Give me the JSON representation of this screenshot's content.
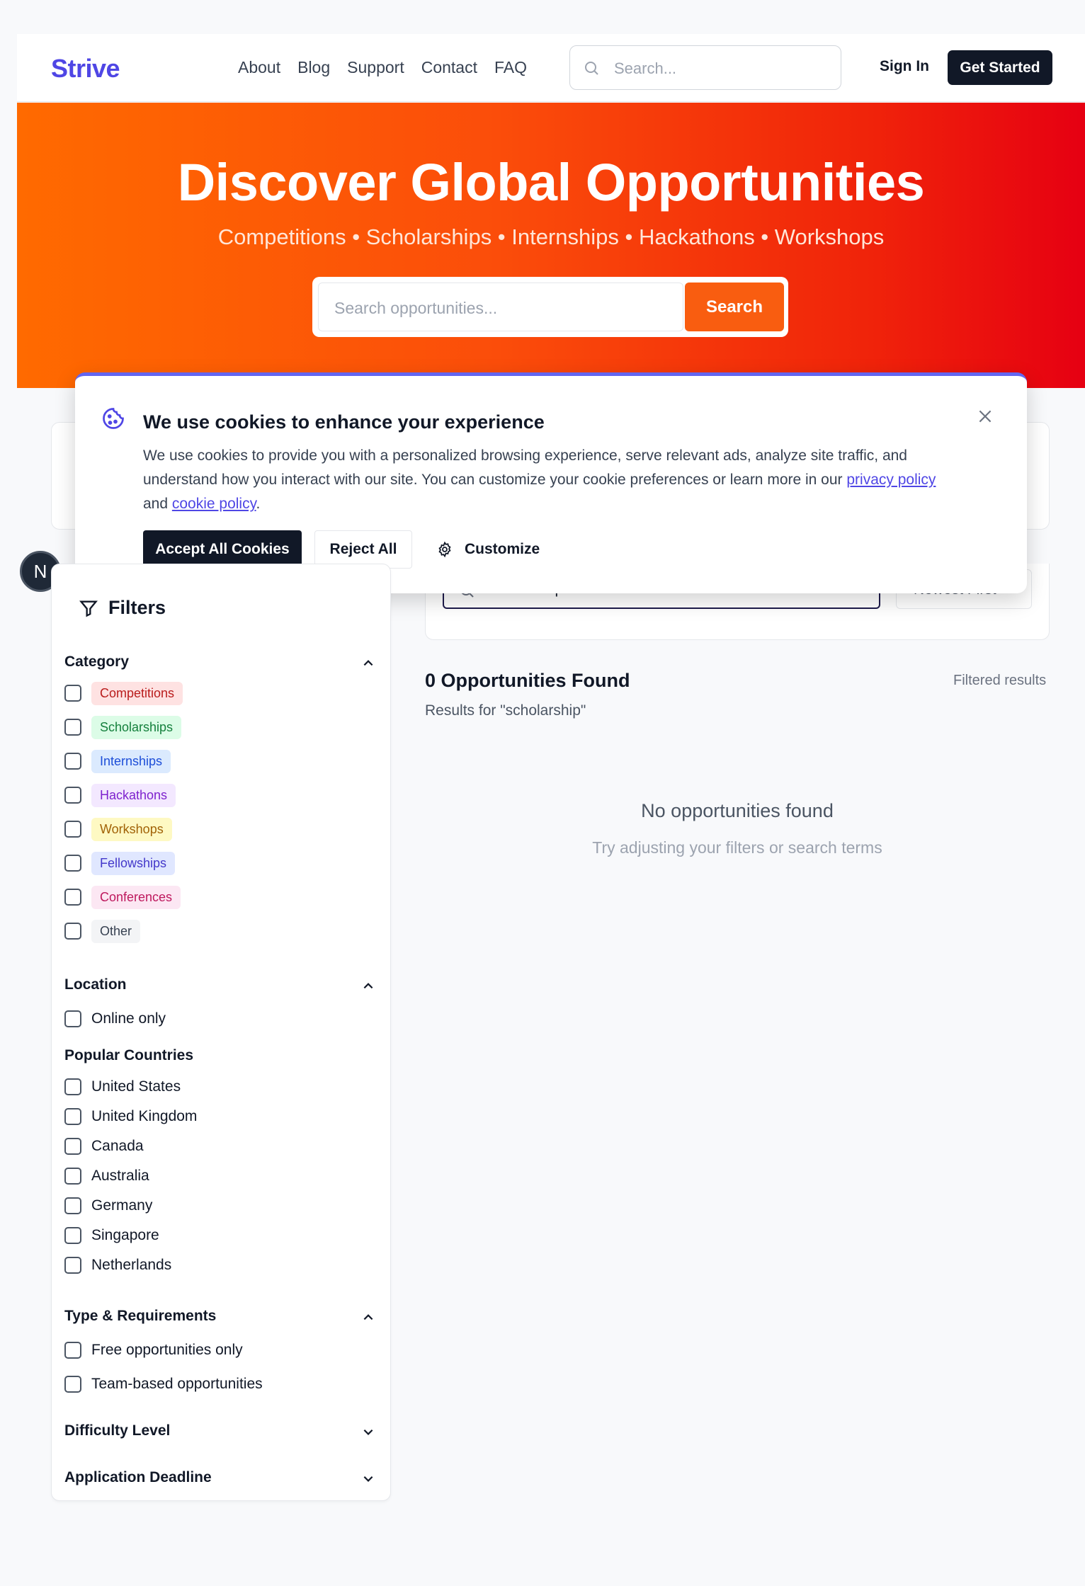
{
  "header": {
    "logo": "Strive",
    "nav": [
      "About",
      "Blog",
      "Support",
      "Contact",
      "FAQ"
    ],
    "search_placeholder": "Search...",
    "sign_in": "Sign In",
    "get_started": "Get Started"
  },
  "hero": {
    "title": "Discover Global Opportunities",
    "subtitle": "Competitions • Scholarships • Internships • Hackathons • Workshops",
    "search_placeholder": "Search opportunities...",
    "search_button": "Search"
  },
  "cookie": {
    "title": "We use cookies to enhance your experience",
    "body_pre": "We use cookies to provide you with a personalized browsing experience, serve relevant ads, analyze site traffic, and understand how you interact with our site. You can customize your cookie preferences or learn more in our ",
    "privacy_link": "privacy policy",
    "body_mid": " and ",
    "cookie_link": "cookie policy",
    "body_end": ".",
    "accept": "Accept All Cookies",
    "reject": "Reject All",
    "customize": "Customize"
  },
  "badge": "N",
  "filters": {
    "title": "Filters",
    "category_title": "Category",
    "categories": [
      {
        "label": "Competitions",
        "bg": "#fee2e2",
        "fg": "#b91c1c"
      },
      {
        "label": "Scholarships",
        "bg": "#dcfce7",
        "fg": "#15803d"
      },
      {
        "label": "Internships",
        "bg": "#dbeafe",
        "fg": "#1d4ed8"
      },
      {
        "label": "Hackathons",
        "bg": "#f3e8ff",
        "fg": "#7e22ce"
      },
      {
        "label": "Workshops",
        "bg": "#fef9c3",
        "fg": "#a16207"
      },
      {
        "label": "Fellowships",
        "bg": "#e0e7ff",
        "fg": "#4338ca"
      },
      {
        "label": "Conferences",
        "bg": "#fce7f3",
        "fg": "#be185d"
      },
      {
        "label": "Other",
        "bg": "#f3f4f6",
        "fg": "#374151"
      }
    ],
    "location_title": "Location",
    "online_only": "Online only",
    "popular_countries_title": "Popular Countries",
    "countries": [
      "United States",
      "United Kingdom",
      "Canada",
      "Australia",
      "Germany",
      "Singapore",
      "Netherlands"
    ],
    "type_title": "Type & Requirements",
    "type_options": [
      "Free opportunities only",
      "Team-based opportunities"
    ],
    "difficulty_title": "Difficulty Level",
    "deadline_title": "Application Deadline"
  },
  "results": {
    "search_value": "scholarship",
    "sort_value": "Newest First",
    "count_title": "0 Opportunities Found",
    "results_for": "Results for \"scholarship\"",
    "filtered_label": "Filtered results",
    "empty_title": "No opportunities found",
    "empty_sub": "Try adjusting your filters or search terms"
  }
}
